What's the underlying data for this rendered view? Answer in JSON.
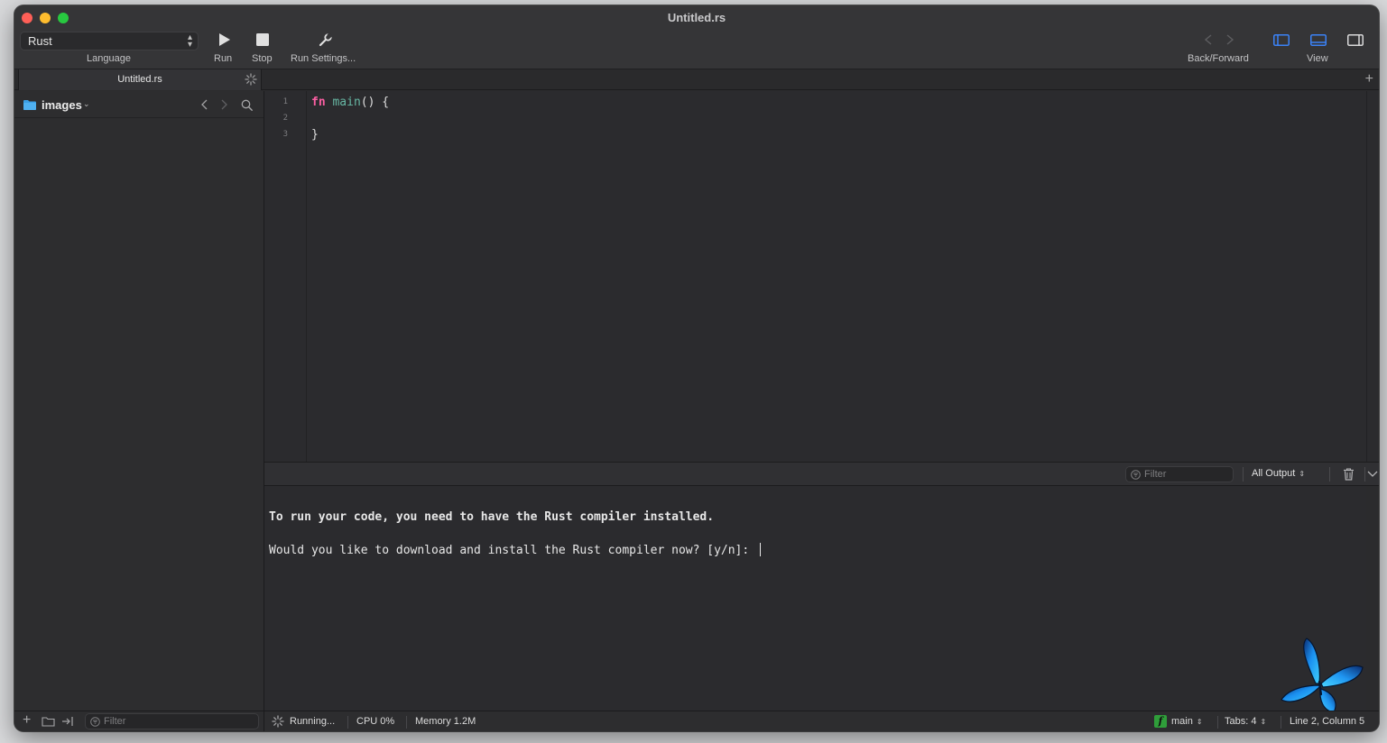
{
  "window": {
    "title": "Untitled.rs"
  },
  "toolbar": {
    "language_value": "Rust",
    "language_label": "Language",
    "run_label": "Run",
    "stop_label": "Stop",
    "run_settings_label": "Run Settings...",
    "back_forward_label": "Back/Forward",
    "view_label": "View"
  },
  "tabs": [
    {
      "label": "Untitled.rs",
      "active": true
    }
  ],
  "sidebar": {
    "folder_name": "images",
    "filter_placeholder": "Filter"
  },
  "editor": {
    "line_numbers": [
      "1",
      "2",
      "3"
    ],
    "lines": [
      {
        "keyword": "fn",
        "name": "main",
        "rest": "() {"
      },
      {
        "text": ""
      },
      {
        "text": "}"
      }
    ]
  },
  "console": {
    "filter_placeholder": "Filter",
    "output_select": "All Output",
    "lines": [
      "To run your code, you need to have the Rust compiler installed.",
      "Would you like to download and install the Rust compiler now? [y/n]: "
    ]
  },
  "statusbar": {
    "state": "Running...",
    "cpu": "CPU 0%",
    "memory": "Memory 1.2M",
    "branch": "main",
    "tabs": "Tabs: 4",
    "cursor": "Line 2, Column 5"
  },
  "colors": {
    "accent": "#3b82f6",
    "keyword": "#fc5fa3",
    "function": "#67b7a4",
    "branch_badge": "#2f9e3a"
  }
}
